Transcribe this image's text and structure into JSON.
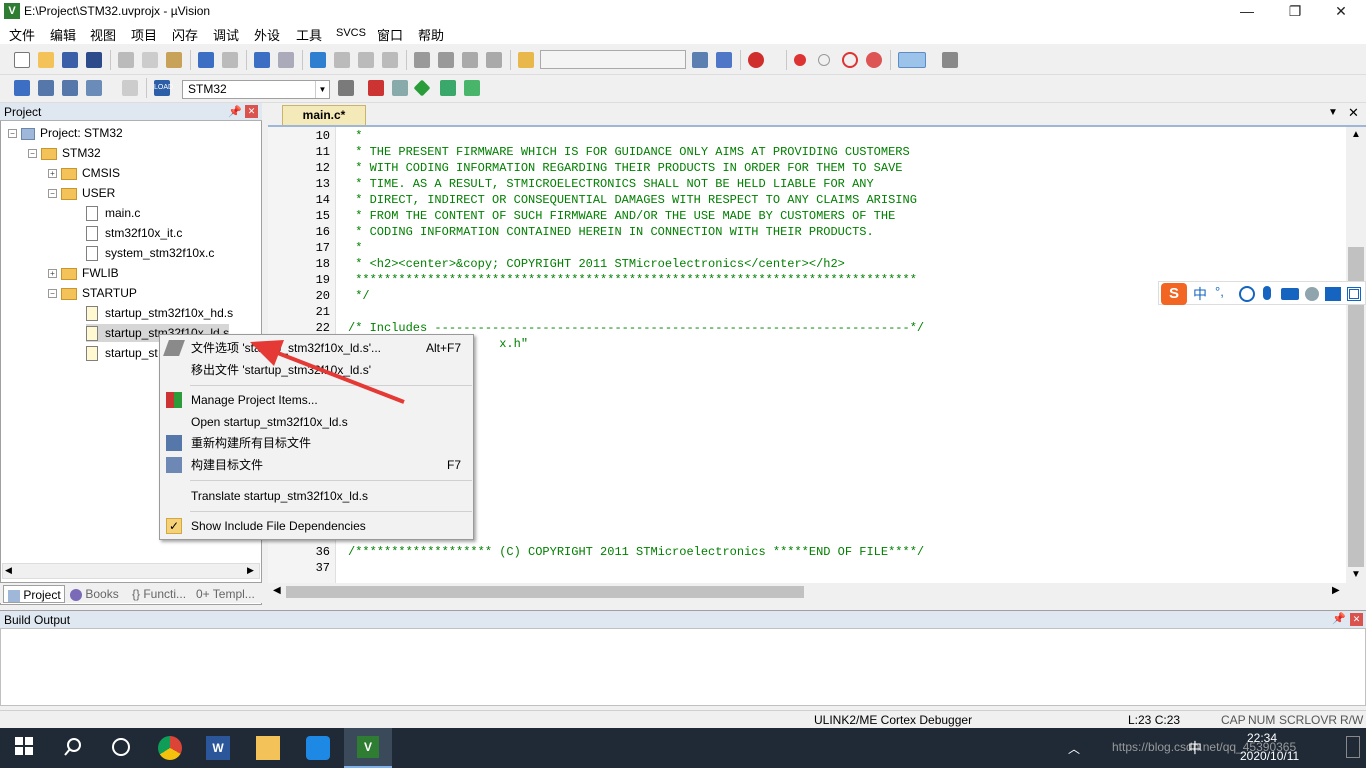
{
  "window": {
    "title": "E:\\Project\\STM32.uvprojx - µVision",
    "app_icon_letter": "V",
    "controls": {
      "minimize": "—",
      "maximize": "❐",
      "close": "✕"
    }
  },
  "menu": [
    "文件",
    "编辑",
    "视图",
    "项目",
    "闪存",
    "调试",
    "外设",
    "工具",
    "SVCS",
    "窗口",
    "帮助"
  ],
  "toolbar2": {
    "target": "STM32",
    "target_options_label": "LOAD"
  },
  "project_panel": {
    "title": "Project",
    "tree": {
      "root": "Project: STM32",
      "target": "STM32",
      "groups": [
        {
          "name": "CMSIS",
          "expanded": false
        },
        {
          "name": "USER",
          "expanded": true,
          "files": [
            "main.c",
            "stm32f10x_it.c",
            "system_stm32f10x.c"
          ]
        },
        {
          "name": "FWLIB",
          "expanded": false
        },
        {
          "name": "STARTUP",
          "expanded": true,
          "files": [
            "startup_stm32f10x_hd.s",
            "startup_stm32f10x_ld.s",
            "startup_stm32f10x_md.s"
          ]
        }
      ]
    },
    "tabs": [
      "Project",
      "Books",
      "{} Functi...",
      "0+ Templ..."
    ]
  },
  "editor": {
    "tab": "main.c*",
    "lines": [
      {
        "n": "10",
        "text": " *"
      },
      {
        "n": "11",
        "text": " * THE PRESENT FIRMWARE WHICH IS FOR GUIDANCE ONLY AIMS AT PROVIDING CUSTOMERS"
      },
      {
        "n": "12",
        "text": " * WITH CODING INFORMATION REGARDING THEIR PRODUCTS IN ORDER FOR THEM TO SAVE"
      },
      {
        "n": "13",
        "text": " * TIME. AS A RESULT, STMICROELECTRONICS SHALL NOT BE HELD LIABLE FOR ANY"
      },
      {
        "n": "14",
        "text": " * DIRECT, INDIRECT OR CONSEQUENTIAL DAMAGES WITH RESPECT TO ANY CLAIMS ARISING"
      },
      {
        "n": "15",
        "text": " * FROM THE CONTENT OF SUCH FIRMWARE AND/OR THE USE MADE BY CUSTOMERS OF THE"
      },
      {
        "n": "16",
        "text": " * CODING INFORMATION CONTAINED HEREIN IN CONNECTION WITH THEIR PRODUCTS."
      },
      {
        "n": "17",
        "text": " *"
      },
      {
        "n": "18",
        "text": " * <h2><center>&copy; COPYRIGHT 2011 STMicroelectronics</center></h2>"
      },
      {
        "n": "19",
        "text": " ******************************************************************************"
      },
      {
        "n": "20",
        "text": " */"
      },
      {
        "n": "21",
        "text": ""
      },
      {
        "n": "22",
        "text": "/* Includes ------------------------------------------------------------------*/"
      },
      {
        "n": "",
        "text": "                     x.h\""
      }
    ],
    "tail_lines": [
      {
        "n": "36",
        "text": "/******************* (C) COPYRIGHT 2011 STMicroelectronics *****END OF FILE****/"
      },
      {
        "n": "37",
        "text": ""
      }
    ]
  },
  "context_menu": {
    "items": [
      {
        "label": "文件选项 'startup_stm32f10x_ld.s'...",
        "shortcut": "Alt+F7",
        "icon": "wand-icon"
      },
      {
        "label": "移出文件 'startup_stm32f10x_ld.s'",
        "shortcut": ""
      },
      {
        "label": "Manage Project Items...",
        "shortcut": "",
        "icon": "manage-items-icon"
      },
      {
        "label": "Open startup_stm32f10x_ld.s",
        "shortcut": ""
      },
      {
        "label": "重新构建所有目标文件",
        "shortcut": "",
        "icon": "rebuild-icon"
      },
      {
        "label": "构建目标文件",
        "shortcut": "F7",
        "icon": "build-icon"
      },
      {
        "label": "Translate startup_stm32f10x_ld.s",
        "shortcut": ""
      },
      {
        "label": "Show Include File Dependencies",
        "shortcut": "",
        "checked": true
      }
    ]
  },
  "build_output": {
    "title": "Build Output"
  },
  "status": {
    "debugger": "ULINK2/ME Cortex Debugger",
    "position": "L:23 C:23",
    "caps": "CAP",
    "num": "NUM",
    "scrl": "SCRL",
    "ovr": "OVR",
    "rw": "R/W"
  },
  "ime": {
    "chars": [
      "中",
      "°,"
    ]
  },
  "taskbar": {
    "time": "22:34",
    "date": "2020/10/11",
    "watermark": "https://blog.csdn.net/qq_45390365",
    "tray_lang": "中"
  },
  "colors": {
    "code_comment": "#008000",
    "tab_active": "#f4e9b8",
    "panel_header": "#dfe7f1",
    "taskbar": "#1f2a36",
    "arrow": "#e53935"
  }
}
